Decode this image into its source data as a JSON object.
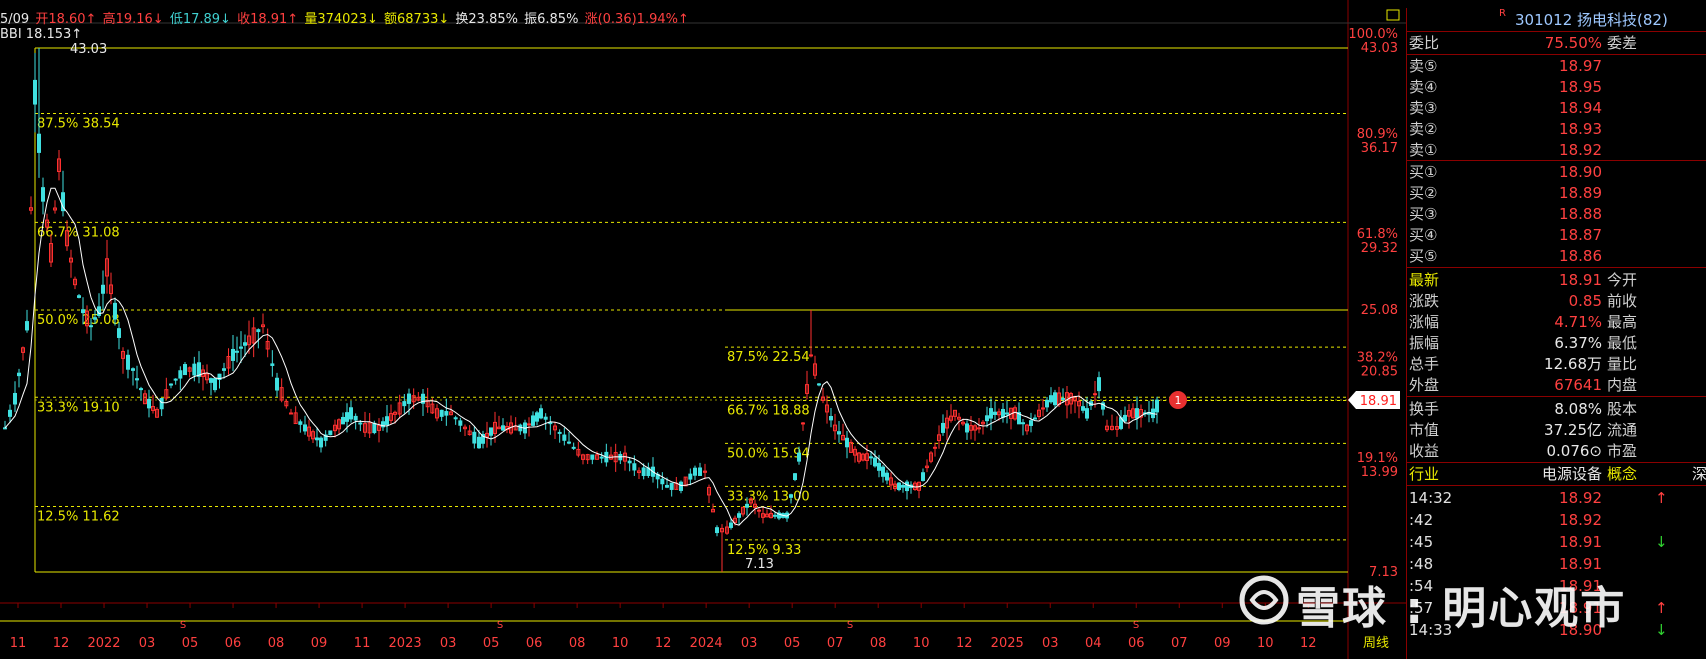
{
  "topbar": {
    "date": "5/09",
    "open": "开18.60↑",
    "high": "高19.16↓",
    "low": "低17.89↓",
    "close": "收18.91↑",
    "volume": "量374023↓",
    "amount": "额68733↓",
    "turnover": "换23.85%",
    "amplitude": "振6.85%",
    "change": "涨(0.36)1.94%↑",
    "indicator": "BBI 18.153↑"
  },
  "price_axis": {
    "labels": [
      {
        "pct": "100.0%",
        "price": "43.03"
      },
      {
        "pct": "80.9%",
        "price": "36.17"
      },
      {
        "pct": "61.8%",
        "price": "29.32"
      },
      {
        "pct": "",
        "price": "25.08"
      },
      {
        "pct": "38.2%",
        "price": "20.85"
      },
      {
        "pct": "19.1%",
        "price": "13.99"
      },
      {
        "pct": "",
        "price": "7.13"
      }
    ],
    "current_price": "18.91",
    "marker": "1"
  },
  "fib_left": {
    "top": "43.03",
    "levels": [
      "87.5% 38.54",
      "66.7% 31.08",
      "50.0% 25.08",
      "33.3% 19.10",
      "12.5% 11.62"
    ],
    "bottom": "7.13"
  },
  "fib_right": {
    "levels": [
      "87.5% 22.54",
      "66.7% 18.88",
      "50.0% 15.94",
      "33.3% 13.00",
      "12.5% 9.33"
    ]
  },
  "x_axis": {
    "labels": [
      "11",
      "12",
      "2022",
      "03",
      "05",
      "06",
      "08",
      "09",
      "11",
      "2023",
      "03",
      "05",
      "06",
      "08",
      "10",
      "12",
      "2024",
      "03",
      "05",
      "07",
      "08",
      "10",
      "12",
      "2025",
      "03",
      "04",
      "06",
      "07",
      "09",
      "10",
      "12"
    ],
    "period": "周线"
  },
  "stock": {
    "code": "301012",
    "name": "扬电科技",
    "rank": "(82)",
    "badge": "R"
  },
  "order_book": {
    "ratio_label": "委比",
    "ratio_value": "75.50%",
    "diff_label": "委差",
    "sells": [
      {
        "label": "卖⑤",
        "price": "18.97"
      },
      {
        "label": "卖④",
        "price": "18.95"
      },
      {
        "label": "卖③",
        "price": "18.94"
      },
      {
        "label": "卖②",
        "price": "18.93"
      },
      {
        "label": "卖①",
        "price": "18.92"
      }
    ],
    "buys": [
      {
        "label": "买①",
        "price": "18.90"
      },
      {
        "label": "买②",
        "price": "18.89"
      },
      {
        "label": "买③",
        "price": "18.88"
      },
      {
        "label": "买④",
        "price": "18.87"
      },
      {
        "label": "买⑤",
        "price": "18.86"
      }
    ]
  },
  "quote": [
    {
      "label": "最新",
      "value": "18.91",
      "label2": "今开",
      "color": "#ff4040",
      "lcolor": "#e8e800"
    },
    {
      "label": "涨跌",
      "value": "0.85",
      "label2": "前收",
      "color": "#ff4040",
      "lcolor": "#d0d0d0"
    },
    {
      "label": "涨幅",
      "value": "4.71%",
      "label2": "最高",
      "color": "#ff4040",
      "lcolor": "#d0d0d0"
    },
    {
      "label": "振幅",
      "value": "6.37%",
      "label2": "最低",
      "color": "#e8e8e8",
      "lcolor": "#d0d0d0"
    },
    {
      "label": "总手",
      "value": "12.68万",
      "label2": "量比",
      "color": "#e8e8e8",
      "lcolor": "#d0d0d0"
    },
    {
      "label": "外盘",
      "value": "67641",
      "label2": "内盘",
      "color": "#ff4040",
      "lcolor": "#d0d0d0"
    }
  ],
  "fundamentals": [
    {
      "label": "换手",
      "value": "8.08%",
      "label2": "股本"
    },
    {
      "label": "市值",
      "value": "37.25亿",
      "label2": "流通"
    },
    {
      "label": "收益",
      "value": "0.076⊙",
      "label2": "市盈"
    }
  ],
  "industry": {
    "label": "行业",
    "value": "电源设备",
    "label2": "概念",
    "extra": "深"
  },
  "ticks": [
    {
      "time": "14:32",
      "price": "18.92",
      "arrow": "↑",
      "acolor": "#ff4040"
    },
    {
      "time": ":42",
      "price": "18.92",
      "arrow": "",
      "acolor": "#ff4040"
    },
    {
      "time": ":45",
      "price": "18.91",
      "arrow": "↓",
      "acolor": "#30d030"
    },
    {
      "time": ":48",
      "price": "18.91",
      "arrow": "",
      "acolor": "#ff4040"
    },
    {
      "time": ":54",
      "price": "18.91",
      "arrow": "",
      "acolor": "#ff4040"
    },
    {
      "time": ":57",
      "price": "18.91",
      "arrow": "↑",
      "acolor": "#ff4040"
    },
    {
      "time": "14:33",
      "price": "18.90",
      "arrow": "↓",
      "acolor": "#30d030"
    }
  ],
  "watermark": "雪球 : 明心观市",
  "colors": {
    "up": "#ff3030",
    "down": "#40e0e0",
    "fib": "#e8e800",
    "grid": "#8b0000",
    "ma": "#ffffff"
  }
}
